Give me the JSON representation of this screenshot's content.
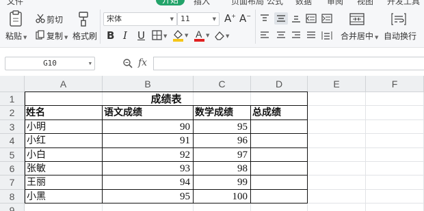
{
  "menu": {
    "items": [
      "文件",
      "开始",
      "插入",
      "页面布局",
      "公式",
      "数据",
      "审阅",
      "视图",
      "开发工具"
    ],
    "active_index": 1
  },
  "ribbon": {
    "cut": "剪切",
    "paste": "粘贴",
    "copy": "复制",
    "format_painter": "格式刷",
    "font_name": "宋体",
    "font_size": "11",
    "bold": "B",
    "italic": "I",
    "underline": "U",
    "merge_center": "合并居中",
    "wrap_text": "自动换行",
    "font_color": "#e02020",
    "fill_color": "#f5c518"
  },
  "formula_bar": {
    "name_box": "G10",
    "fx": "fx",
    "formula": ""
  },
  "columns": [
    "A",
    "B",
    "C",
    "D",
    "E",
    "F"
  ],
  "rows": [
    "1",
    "2",
    "3",
    "4",
    "5",
    "6",
    "7",
    "8",
    "9"
  ],
  "table": {
    "title": "成绩表",
    "headers": [
      "姓名",
      "语文成绩",
      "数学成绩",
      "总成绩"
    ],
    "records": [
      {
        "name": "小明",
        "chinese": "90",
        "math": "95",
        "total": ""
      },
      {
        "name": "小红",
        "chinese": "91",
        "math": "96",
        "total": ""
      },
      {
        "name": "小白",
        "chinese": "92",
        "math": "97",
        "total": ""
      },
      {
        "name": "张敏",
        "chinese": "93",
        "math": "98",
        "total": ""
      },
      {
        "name": "王丽",
        "chinese": "94",
        "math": "99",
        "total": ""
      },
      {
        "name": "小黑",
        "chinese": "95",
        "math": "100",
        "total": ""
      }
    ]
  }
}
